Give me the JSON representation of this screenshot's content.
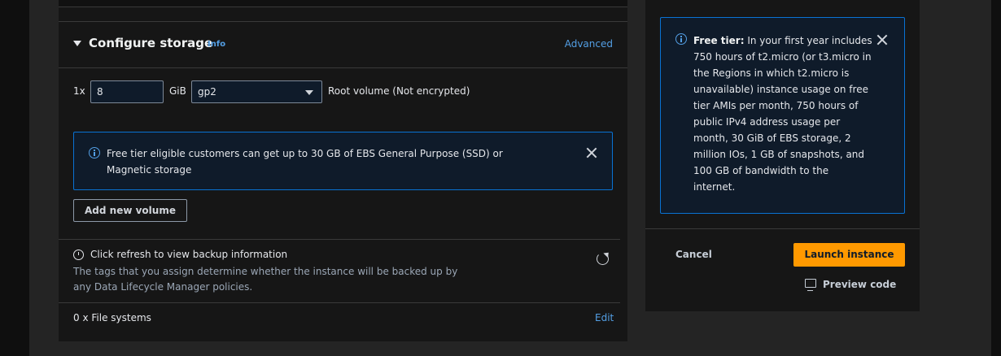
{
  "storage": {
    "title": "Configure storage",
    "info_link": "Info",
    "advanced_link": "Advanced",
    "volume": {
      "count_label": "1x",
      "size_value": "8",
      "unit_label": "GiB",
      "type_value": "gp2",
      "description": "Root volume  (Not encrypted)"
    },
    "alert_text": "Free tier eligible customers can get up to 30 GB of EBS General Purpose (SSD) or Magnetic storage",
    "add_volume_label": "Add new volume",
    "backup": {
      "title": "Click refresh to view backup information",
      "description": "The tags that you assign determine whether the instance will be backed up by any Data Lifecycle Manager policies."
    },
    "file_systems_label": "0 x File systems",
    "edit_link": "Edit"
  },
  "summary": {
    "free_tier_heading": "Free tier:",
    "free_tier_body": " In your first year includes 750 hours of t2.micro (or t3.micro in the Regions in which t2.micro is unavailable) instance usage on free tier AMIs per month, 750 hours of public IPv4 address usage per month, 30 GiB of EBS storage, 2 million IOs, 1 GB of snapshots, and 100 GB of bandwidth to the internet.",
    "cancel_label": "Cancel",
    "launch_label": "Launch instance",
    "preview_code_label": "Preview code"
  },
  "colors": {
    "accent_orange": "#ff9900",
    "link_blue": "#539fe5",
    "info_border": "#0972d3"
  }
}
